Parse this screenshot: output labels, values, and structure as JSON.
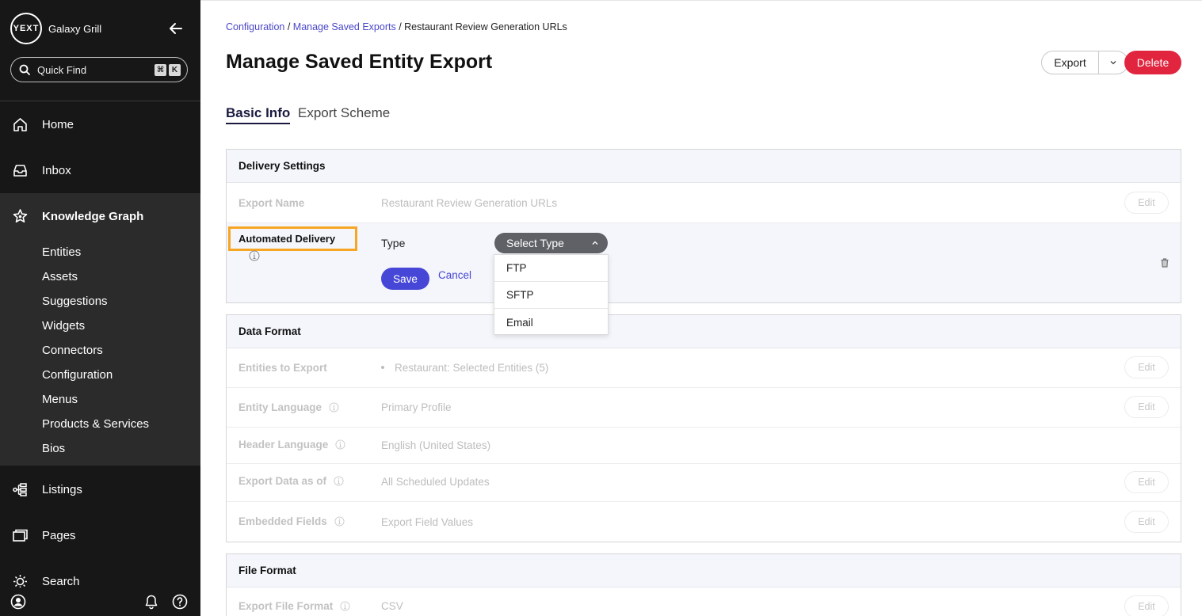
{
  "sidebar": {
    "logo_text": "YEXT",
    "account_name": "Galaxy Grill",
    "quick_find": {
      "label": "Quick Find",
      "shortcut_mod": "⌘",
      "shortcut_key": "K"
    },
    "nav": {
      "home": "Home",
      "inbox": "Inbox",
      "knowledge_graph": "Knowledge Graph",
      "listings": "Listings",
      "pages": "Pages",
      "search": "Search"
    },
    "sub_items": [
      "Entities",
      "Assets",
      "Suggestions",
      "Widgets",
      "Connectors",
      "Configuration",
      "Menus",
      "Products & Services",
      "Bios"
    ]
  },
  "breadcrumb": {
    "item1": "Configuration",
    "sep": " / ",
    "item2": "Manage Saved Exports",
    "current": "Restaurant Review Generation URLs"
  },
  "page": {
    "title": "Manage Saved Entity Export",
    "export_label": "Export",
    "delete_label": "Delete"
  },
  "tabs": {
    "basic_info": "Basic Info",
    "export_scheme": "Export Scheme"
  },
  "delivery_settings": {
    "header": "Delivery Settings",
    "export_name_label": "Export Name",
    "export_name_value": "Restaurant Review Generation URLs",
    "edit_label": "Edit",
    "automated_delivery_label": "Automated Delivery",
    "type_label": "Type",
    "select_placeholder": "Select Type",
    "save_label": "Save",
    "cancel_label": "Cancel",
    "type_options": [
      "FTP",
      "SFTP",
      "Email"
    ]
  },
  "data_format": {
    "header": "Data Format",
    "rows": [
      {
        "label": "Entities to Export",
        "value": "Restaurant: Selected Entities (5)",
        "edit": "Edit"
      },
      {
        "label": "Entity Language",
        "value": "Primary Profile",
        "edit": "Edit"
      },
      {
        "label": "Header Language",
        "value": "English (United States)"
      },
      {
        "label": "Export Data as of",
        "value": "All Scheduled Updates",
        "edit": "Edit"
      },
      {
        "label": "Embedded Fields",
        "value": "Export Field Values",
        "edit": "Edit"
      }
    ]
  },
  "file_format": {
    "header": "File Format",
    "rows": [
      {
        "label": "Export File Format",
        "value": "CSV",
        "edit": "Edit"
      }
    ]
  },
  "colors": {
    "sidebar_bg": "#171717",
    "sidebar_active": "#2b2b2b",
    "accent": "#4646d7",
    "delete": "#e1253f",
    "highlight": "#f6a623"
  }
}
